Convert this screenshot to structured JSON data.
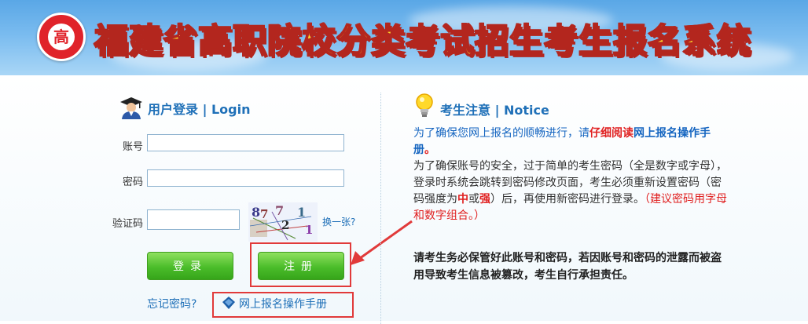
{
  "header": {
    "title": "福建省高职院校分类考试招生考生报名系统",
    "logo_char": "高"
  },
  "login": {
    "heading": "用户登录 | Login",
    "account_label": "账号",
    "password_label": "密码",
    "captcha_label": "验证码",
    "captcha_text": "87 7 2 1 1",
    "refresh_link": "换一张?",
    "login_button": "登录",
    "register_button": "注册",
    "forgot_link": "忘记密码?",
    "manual_link": "网上报名操作手册"
  },
  "notice": {
    "heading": "考生注意 | Notice",
    "p1_a": "为了确保您网上报名的顺畅进行，请",
    "p1_b": "仔细阅读",
    "p1_c": "网上报名操作手册",
    "p1_d": "。",
    "p2_a": "为了确保账号的安全，过于简单的考生密码（全是数字或字母），登录时系统会跳转到密码修改页面，考生必须重新设置密码（密码强度为",
    "p2_b": "中",
    "p2_c": "或",
    "p2_d": "强",
    "p2_e": "）后，再使用新密码进行登录。",
    "p2_f": "（建议密码用字母和数字组合。）",
    "p3": "请考生务必保管好此账号和密码，若因账号和密码的泄露而被盗用导致考生信息被篡改，考生自行承担责任。"
  },
  "colors": {
    "accent_blue": "#1f70b8",
    "button_green": "#4bbd2a",
    "highlight_red": "#e13a3a"
  }
}
